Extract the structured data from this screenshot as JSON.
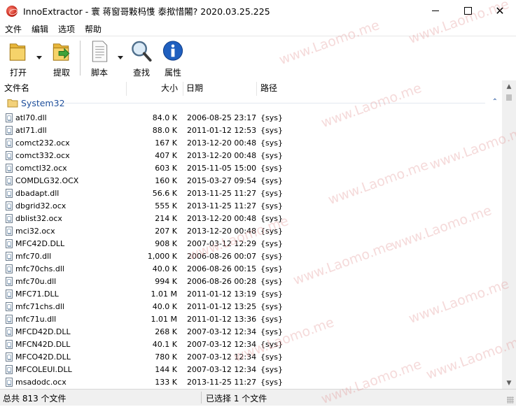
{
  "window": {
    "title": "InnoExtractor - 寰 蒋窗哥敤杩愯 泰揿惜闂? 2020.03.25.225",
    "minimize_glyph": "—",
    "close_glyph": "✕"
  },
  "menu": [
    "文件",
    "编辑",
    "选项",
    "帮助"
  ],
  "toolbar": {
    "open": "打开",
    "extract": "提取",
    "script": "脚本",
    "find": "查找",
    "properties": "属性"
  },
  "columns": {
    "name": "文件名",
    "size": "大小",
    "date": "日期",
    "path": "路径"
  },
  "group": {
    "label": "System32",
    "collapse_glyph": "⌃"
  },
  "files": [
    {
      "name": "atl70.dll",
      "size": "84.0 K",
      "date": "2006-08-25 23:17",
      "path": "{sys}"
    },
    {
      "name": "atl71.dll",
      "size": "88.0 K",
      "date": "2011-01-12 12:53",
      "path": "{sys}"
    },
    {
      "name": "comct232.ocx",
      "size": "167 K",
      "date": "2013-12-20 00:48",
      "path": "{sys}"
    },
    {
      "name": "comct332.ocx",
      "size": "407 K",
      "date": "2013-12-20 00:48",
      "path": "{sys}"
    },
    {
      "name": "comctl32.ocx",
      "size": "603 K",
      "date": "2015-11-05 15:00",
      "path": "{sys}"
    },
    {
      "name": "COMDLG32.OCX",
      "size": "160 K",
      "date": "2015-03-27 09:54",
      "path": "{sys}"
    },
    {
      "name": "dbadapt.dll",
      "size": "56.6 K",
      "date": "2013-11-25 11:27",
      "path": "{sys}"
    },
    {
      "name": "dbgrid32.ocx",
      "size": "555 K",
      "date": "2013-11-25 11:27",
      "path": "{sys}"
    },
    {
      "name": "dblist32.ocx",
      "size": "214 K",
      "date": "2013-12-20 00:48",
      "path": "{sys}"
    },
    {
      "name": "mci32.ocx",
      "size": "207 K",
      "date": "2013-12-20 00:48",
      "path": "{sys}"
    },
    {
      "name": "MFC42D.DLL",
      "size": "908 K",
      "date": "2007-03-12 12:29",
      "path": "{sys}"
    },
    {
      "name": "mfc70.dll",
      "size": "1,000 K",
      "date": "2006-08-26 00:07",
      "path": "{sys}"
    },
    {
      "name": "mfc70chs.dll",
      "size": "40.0 K",
      "date": "2006-08-26 00:15",
      "path": "{sys}"
    },
    {
      "name": "mfc70u.dll",
      "size": "994 K",
      "date": "2006-08-26 00:28",
      "path": "{sys}"
    },
    {
      "name": "MFC71.DLL",
      "size": "1.01 M",
      "date": "2011-01-12 13:19",
      "path": "{sys}"
    },
    {
      "name": "mfc71chs.dll",
      "size": "40.0 K",
      "date": "2011-01-12 13:25",
      "path": "{sys}"
    },
    {
      "name": "mfc71u.dll",
      "size": "1.01 M",
      "date": "2011-01-12 13:36",
      "path": "{sys}"
    },
    {
      "name": "MFCD42D.DLL",
      "size": "268 K",
      "date": "2007-03-12 12:34",
      "path": "{sys}"
    },
    {
      "name": "MFCN42D.DLL",
      "size": "40.1 K",
      "date": "2007-03-12 12:34",
      "path": "{sys}"
    },
    {
      "name": "MFCO42D.DLL",
      "size": "780 K",
      "date": "2007-03-12 12:34",
      "path": "{sys}"
    },
    {
      "name": "MFCOLEUI.DLL",
      "size": "144 K",
      "date": "2007-03-12 12:34",
      "path": "{sys}"
    },
    {
      "name": "msadodc.ocx",
      "size": "133 K",
      "date": "2013-11-25 11:27",
      "path": "{sys}"
    }
  ],
  "status": {
    "left": "总共 813 个文件",
    "right": "已选择 1 个文件"
  },
  "watermark": "www.Laomo.me"
}
